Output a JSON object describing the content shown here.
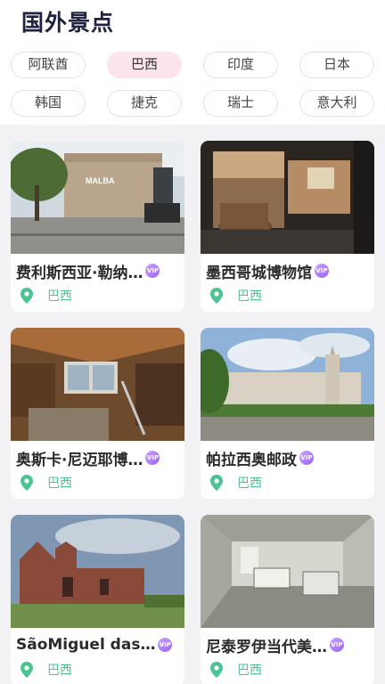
{
  "header": {
    "title": "国外景点"
  },
  "filters": [
    {
      "label": "阿联酋",
      "active": false
    },
    {
      "label": "巴西",
      "active": true
    },
    {
      "label": "印度",
      "active": false
    },
    {
      "label": "日本",
      "active": false
    },
    {
      "label": "韩国",
      "active": false
    },
    {
      "label": "捷克",
      "active": false
    },
    {
      "label": "瑞士",
      "active": false
    },
    {
      "label": "意大利",
      "active": false
    }
  ],
  "cards": [
    {
      "title": "费利斯西亚·勒纳…",
      "location": "巴西",
      "badge": "VIP",
      "photo_text": "MALBA"
    },
    {
      "title": "墨西哥城博物馆",
      "location": "巴西",
      "badge": "VIP"
    },
    {
      "title": "奥斯卡·尼迈耶博…",
      "location": "巴西",
      "badge": "VIP"
    },
    {
      "title": "帕拉西奥邮政",
      "location": "巴西",
      "badge": "VIP"
    },
    {
      "title": "SãoMiguel das…",
      "location": "巴西",
      "badge": "VIP"
    },
    {
      "title": "尼泰罗伊当代美…",
      "location": "巴西",
      "badge": "VIP"
    }
  ],
  "colors": {
    "accent_green": "#4cc492",
    "chip_active_bg": "#fbe4ea",
    "vip_purple": "#9a63f0"
  },
  "icons": {
    "location": "map-pin-icon",
    "vip": "vip-badge-icon"
  }
}
